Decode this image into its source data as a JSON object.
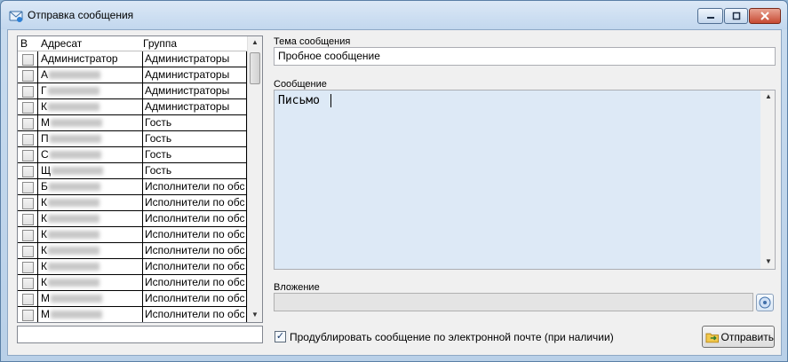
{
  "window": {
    "title": "Отправка сообщения"
  },
  "grid": {
    "headers": {
      "b": "В",
      "addressee": "Адресат",
      "group": "Группа"
    },
    "rows": [
      {
        "addressee": "Администратор",
        "group": "Администраторы",
        "blurred": false
      },
      {
        "addressee": "А",
        "group": "Администраторы",
        "blurred": true
      },
      {
        "addressee": "Г",
        "group": "Администраторы",
        "blurred": true
      },
      {
        "addressee": "К",
        "group": "Администраторы",
        "blurred": true
      },
      {
        "addressee": "М",
        "group": "Гость",
        "blurred": true
      },
      {
        "addressee": "П",
        "group": "Гость",
        "blurred": true
      },
      {
        "addressee": "С",
        "group": "Гость",
        "blurred": true
      },
      {
        "addressee": "Щ",
        "group": "Гость",
        "blurred": true
      },
      {
        "addressee": "Б",
        "group": "Исполнители по обс",
        "blurred": true
      },
      {
        "addressee": "К",
        "group": "Исполнители по обс",
        "blurred": true
      },
      {
        "addressee": "К",
        "group": "Исполнители по обс",
        "blurred": true
      },
      {
        "addressee": "К",
        "group": "Исполнители по обс",
        "blurred": true
      },
      {
        "addressee": "К",
        "group": "Исполнители по обс",
        "blurred": true
      },
      {
        "addressee": "К",
        "group": "Исполнители по обс",
        "blurred": true
      },
      {
        "addressee": "К",
        "group": "Исполнители по обс",
        "blurred": true
      },
      {
        "addressee": "М",
        "group": "Исполнители по обс",
        "blurred": true
      },
      {
        "addressee": "М",
        "group": "Исполнители по обс",
        "blurred": true
      }
    ]
  },
  "subject": {
    "label": "Тема сообщения",
    "value": "Пробное сообщение"
  },
  "message": {
    "label": "Сообщение",
    "value": "Письмо"
  },
  "attachment": {
    "label": "Вложение",
    "value": ""
  },
  "duplicate": {
    "label": "Продублировать сообщение по электронной почте (при наличии)",
    "checked": true
  },
  "send_button": {
    "label": "Отправить"
  }
}
